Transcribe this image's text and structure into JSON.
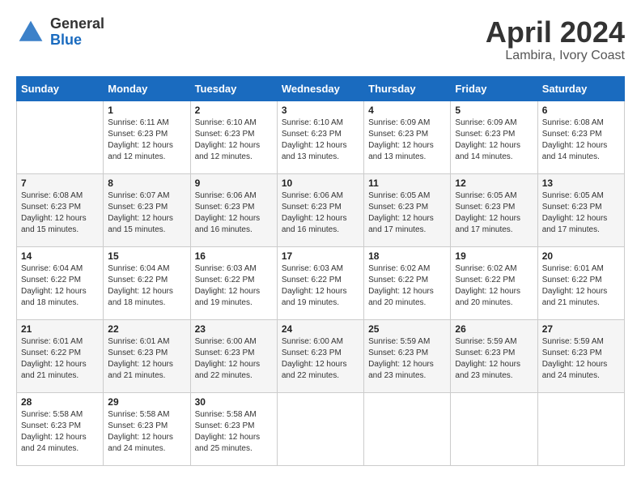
{
  "header": {
    "logo_general": "General",
    "logo_blue": "Blue",
    "month": "April 2024",
    "location": "Lambira, Ivory Coast"
  },
  "days_of_week": [
    "Sunday",
    "Monday",
    "Tuesday",
    "Wednesday",
    "Thursday",
    "Friday",
    "Saturday"
  ],
  "weeks": [
    [
      {
        "day": "",
        "sunrise": "",
        "sunset": "",
        "daylight": ""
      },
      {
        "day": "1",
        "sunrise": "Sunrise: 6:11 AM",
        "sunset": "Sunset: 6:23 PM",
        "daylight": "Daylight: 12 hours and 12 minutes."
      },
      {
        "day": "2",
        "sunrise": "Sunrise: 6:10 AM",
        "sunset": "Sunset: 6:23 PM",
        "daylight": "Daylight: 12 hours and 12 minutes."
      },
      {
        "day": "3",
        "sunrise": "Sunrise: 6:10 AM",
        "sunset": "Sunset: 6:23 PM",
        "daylight": "Daylight: 12 hours and 13 minutes."
      },
      {
        "day": "4",
        "sunrise": "Sunrise: 6:09 AM",
        "sunset": "Sunset: 6:23 PM",
        "daylight": "Daylight: 12 hours and 13 minutes."
      },
      {
        "day": "5",
        "sunrise": "Sunrise: 6:09 AM",
        "sunset": "Sunset: 6:23 PM",
        "daylight": "Daylight: 12 hours and 14 minutes."
      },
      {
        "day": "6",
        "sunrise": "Sunrise: 6:08 AM",
        "sunset": "Sunset: 6:23 PM",
        "daylight": "Daylight: 12 hours and 14 minutes."
      }
    ],
    [
      {
        "day": "7",
        "sunrise": "Sunrise: 6:08 AM",
        "sunset": "Sunset: 6:23 PM",
        "daylight": "Daylight: 12 hours and 15 minutes."
      },
      {
        "day": "8",
        "sunrise": "Sunrise: 6:07 AM",
        "sunset": "Sunset: 6:23 PM",
        "daylight": "Daylight: 12 hours and 15 minutes."
      },
      {
        "day": "9",
        "sunrise": "Sunrise: 6:06 AM",
        "sunset": "Sunset: 6:23 PM",
        "daylight": "Daylight: 12 hours and 16 minutes."
      },
      {
        "day": "10",
        "sunrise": "Sunrise: 6:06 AM",
        "sunset": "Sunset: 6:23 PM",
        "daylight": "Daylight: 12 hours and 16 minutes."
      },
      {
        "day": "11",
        "sunrise": "Sunrise: 6:05 AM",
        "sunset": "Sunset: 6:23 PM",
        "daylight": "Daylight: 12 hours and 17 minutes."
      },
      {
        "day": "12",
        "sunrise": "Sunrise: 6:05 AM",
        "sunset": "Sunset: 6:23 PM",
        "daylight": "Daylight: 12 hours and 17 minutes."
      },
      {
        "day": "13",
        "sunrise": "Sunrise: 6:05 AM",
        "sunset": "Sunset: 6:23 PM",
        "daylight": "Daylight: 12 hours and 17 minutes."
      }
    ],
    [
      {
        "day": "14",
        "sunrise": "Sunrise: 6:04 AM",
        "sunset": "Sunset: 6:22 PM",
        "daylight": "Daylight: 12 hours and 18 minutes."
      },
      {
        "day": "15",
        "sunrise": "Sunrise: 6:04 AM",
        "sunset": "Sunset: 6:22 PM",
        "daylight": "Daylight: 12 hours and 18 minutes."
      },
      {
        "day": "16",
        "sunrise": "Sunrise: 6:03 AM",
        "sunset": "Sunset: 6:22 PM",
        "daylight": "Daylight: 12 hours and 19 minutes."
      },
      {
        "day": "17",
        "sunrise": "Sunrise: 6:03 AM",
        "sunset": "Sunset: 6:22 PM",
        "daylight": "Daylight: 12 hours and 19 minutes."
      },
      {
        "day": "18",
        "sunrise": "Sunrise: 6:02 AM",
        "sunset": "Sunset: 6:22 PM",
        "daylight": "Daylight: 12 hours and 20 minutes."
      },
      {
        "day": "19",
        "sunrise": "Sunrise: 6:02 AM",
        "sunset": "Sunset: 6:22 PM",
        "daylight": "Daylight: 12 hours and 20 minutes."
      },
      {
        "day": "20",
        "sunrise": "Sunrise: 6:01 AM",
        "sunset": "Sunset: 6:22 PM",
        "daylight": "Daylight: 12 hours and 21 minutes."
      }
    ],
    [
      {
        "day": "21",
        "sunrise": "Sunrise: 6:01 AM",
        "sunset": "Sunset: 6:22 PM",
        "daylight": "Daylight: 12 hours and 21 minutes."
      },
      {
        "day": "22",
        "sunrise": "Sunrise: 6:01 AM",
        "sunset": "Sunset: 6:23 PM",
        "daylight": "Daylight: 12 hours and 21 minutes."
      },
      {
        "day": "23",
        "sunrise": "Sunrise: 6:00 AM",
        "sunset": "Sunset: 6:23 PM",
        "daylight": "Daylight: 12 hours and 22 minutes."
      },
      {
        "day": "24",
        "sunrise": "Sunrise: 6:00 AM",
        "sunset": "Sunset: 6:23 PM",
        "daylight": "Daylight: 12 hours and 22 minutes."
      },
      {
        "day": "25",
        "sunrise": "Sunrise: 5:59 AM",
        "sunset": "Sunset: 6:23 PM",
        "daylight": "Daylight: 12 hours and 23 minutes."
      },
      {
        "day": "26",
        "sunrise": "Sunrise: 5:59 AM",
        "sunset": "Sunset: 6:23 PM",
        "daylight": "Daylight: 12 hours and 23 minutes."
      },
      {
        "day": "27",
        "sunrise": "Sunrise: 5:59 AM",
        "sunset": "Sunset: 6:23 PM",
        "daylight": "Daylight: 12 hours and 24 minutes."
      }
    ],
    [
      {
        "day": "28",
        "sunrise": "Sunrise: 5:58 AM",
        "sunset": "Sunset: 6:23 PM",
        "daylight": "Daylight: 12 hours and 24 minutes."
      },
      {
        "day": "29",
        "sunrise": "Sunrise: 5:58 AM",
        "sunset": "Sunset: 6:23 PM",
        "daylight": "Daylight: 12 hours and 24 minutes."
      },
      {
        "day": "30",
        "sunrise": "Sunrise: 5:58 AM",
        "sunset": "Sunset: 6:23 PM",
        "daylight": "Daylight: 12 hours and 25 minutes."
      },
      {
        "day": "",
        "sunrise": "",
        "sunset": "",
        "daylight": ""
      },
      {
        "day": "",
        "sunrise": "",
        "sunset": "",
        "daylight": ""
      },
      {
        "day": "",
        "sunrise": "",
        "sunset": "",
        "daylight": ""
      },
      {
        "day": "",
        "sunrise": "",
        "sunset": "",
        "daylight": ""
      }
    ]
  ]
}
